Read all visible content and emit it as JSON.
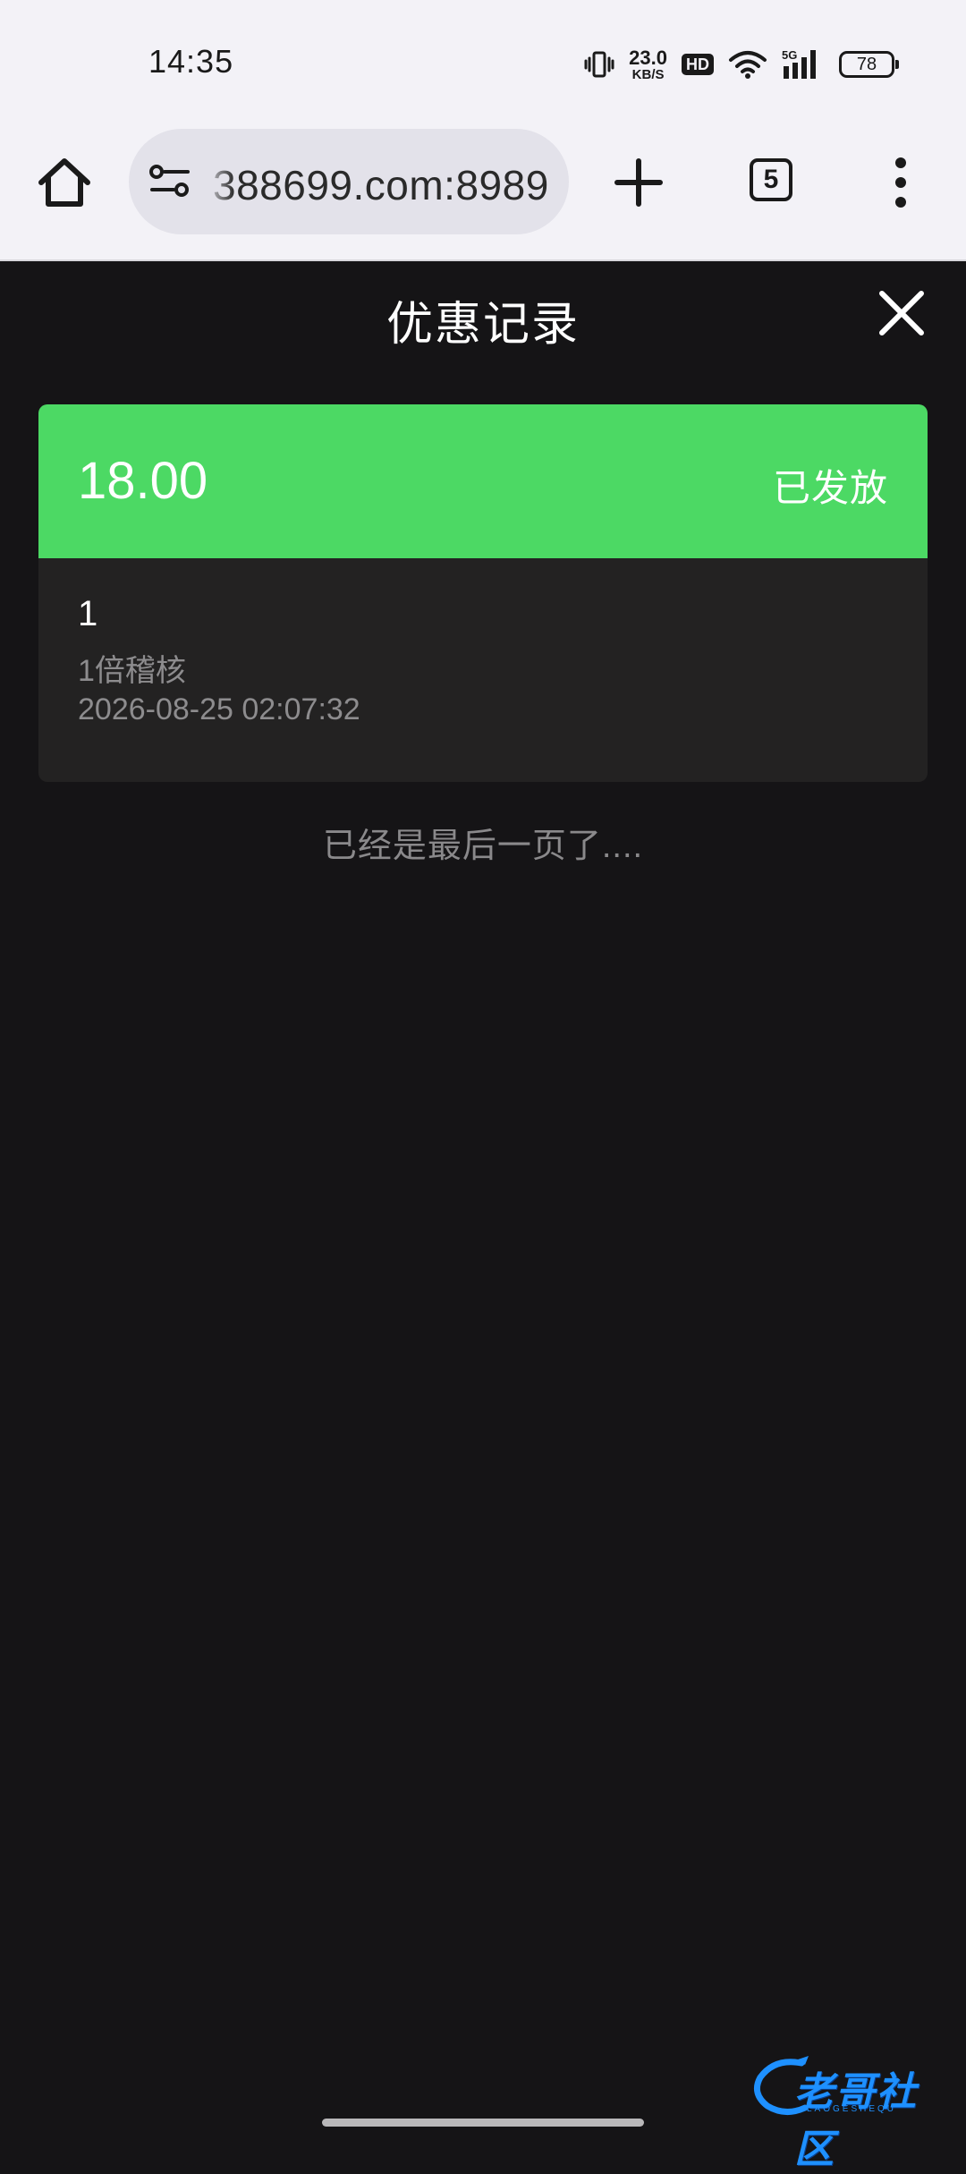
{
  "status_bar": {
    "time": "14:35",
    "net_speed_value": "23.0",
    "net_speed_unit": "KB/S",
    "hd_badge": "HD",
    "signal_label": "5G",
    "battery": "78"
  },
  "browser": {
    "url": "388699.com:8989",
    "tab_count": "5"
  },
  "page": {
    "title": "优惠记录",
    "end_text": "已经是最后一页了...."
  },
  "records": [
    {
      "amount": "18.00",
      "status": "已发放",
      "name": "1",
      "description": "1倍稽核",
      "time": "2026-08-25 02:07:32"
    }
  ],
  "watermark": {
    "text": "老哥社区",
    "subtext": "LAOGESHEQU"
  },
  "colors": {
    "accent_green": "#4cd964",
    "page_background": "#151416",
    "card_background": "#232222"
  }
}
